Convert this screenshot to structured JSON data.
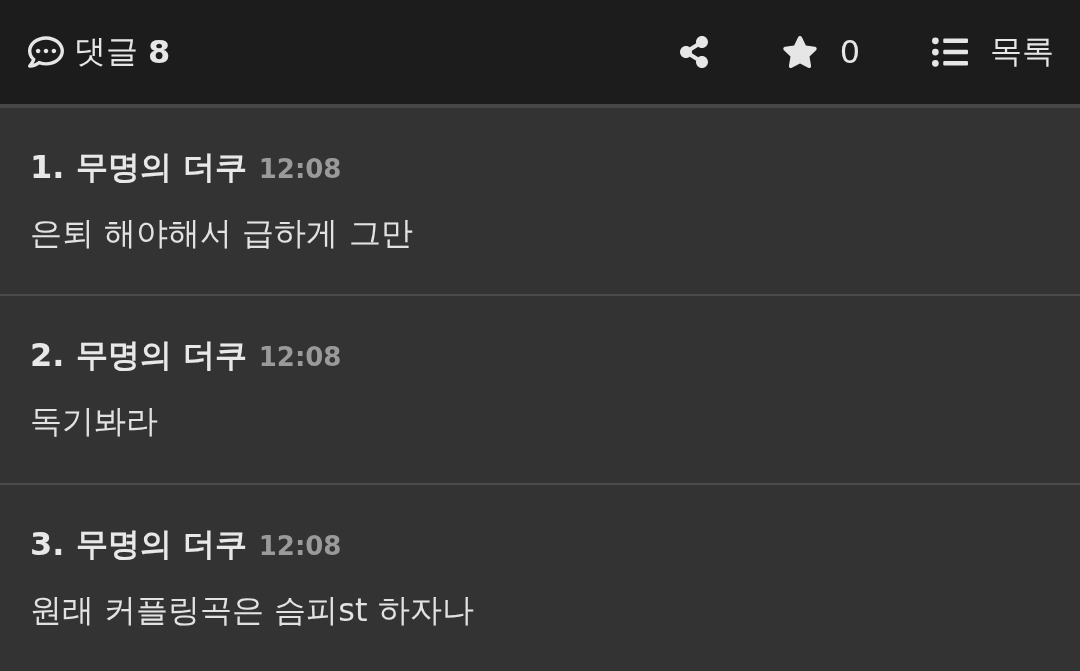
{
  "header": {
    "comments_label": "댓글",
    "comments_count": "8",
    "star_count": "0",
    "list_label": "목록"
  },
  "comments": [
    {
      "number": "1.",
      "author": "무명의 더쿠",
      "time": "12:08",
      "text": "은퇴 해야해서 급하게 그만"
    },
    {
      "number": "2.",
      "author": "무명의 더쿠",
      "time": "12:08",
      "text": "독기봐라"
    },
    {
      "number": "3.",
      "author": "무명의 더쿠",
      "time": "12:08",
      "text": "원래 커플링곡은 슴피st 하자나"
    }
  ]
}
